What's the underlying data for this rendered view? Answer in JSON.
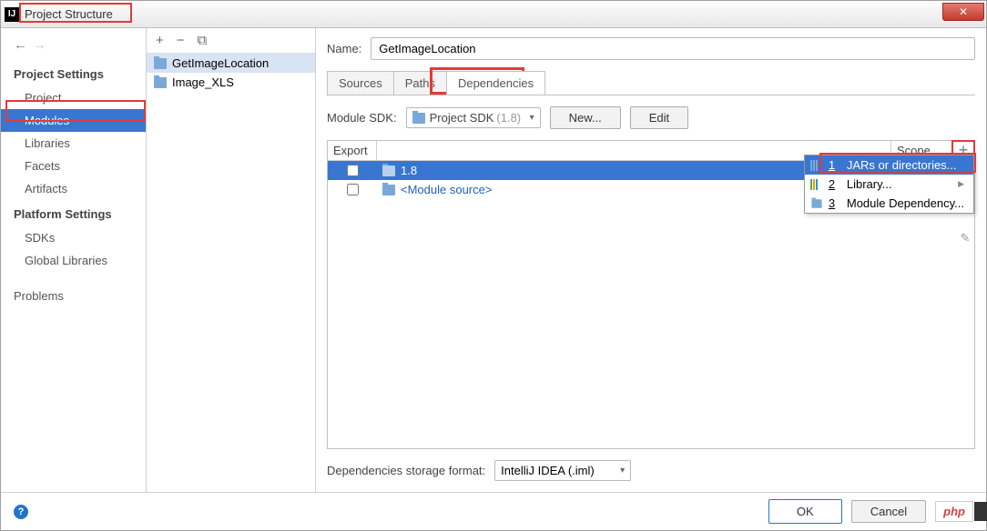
{
  "window": {
    "title": "Project Structure"
  },
  "sidebar": {
    "project_settings_header": "Project Settings",
    "platform_settings_header": "Platform Settings",
    "items_project": "Project",
    "items_modules": "Modules",
    "items_libraries": "Libraries",
    "items_facets": "Facets",
    "items_artifacts": "Artifacts",
    "items_sdks": "SDKs",
    "items_global_libraries": "Global Libraries",
    "items_problems": "Problems"
  },
  "modules": {
    "item0": "GetImageLocation",
    "item1": "Image_XLS"
  },
  "form": {
    "name_label": "Name:",
    "name_value": "GetImageLocation",
    "tab_sources": "Sources",
    "tab_paths": "Paths",
    "tab_dependencies": "Dependencies",
    "sdk_label": "Module SDK:",
    "sdk_selected": "Project SDK",
    "sdk_version": "(1.8)",
    "new_btn": "New...",
    "edit_btn": "Edit",
    "col_export": "Export",
    "col_scope": "Scope",
    "dep0": "1.8",
    "dep1": "<Module source>",
    "storage_label": "Dependencies storage format:",
    "storage_value": "IntelliJ IDEA (.iml)"
  },
  "popup": {
    "item1_num": "1",
    "item1_label": "JARs or directories...",
    "item2_num": "2",
    "item2_label": "Library...",
    "item3_num": "3",
    "item3_label": "Module Dependency..."
  },
  "footer": {
    "ok": "OK",
    "cancel": "Cancel",
    "php": "php"
  }
}
